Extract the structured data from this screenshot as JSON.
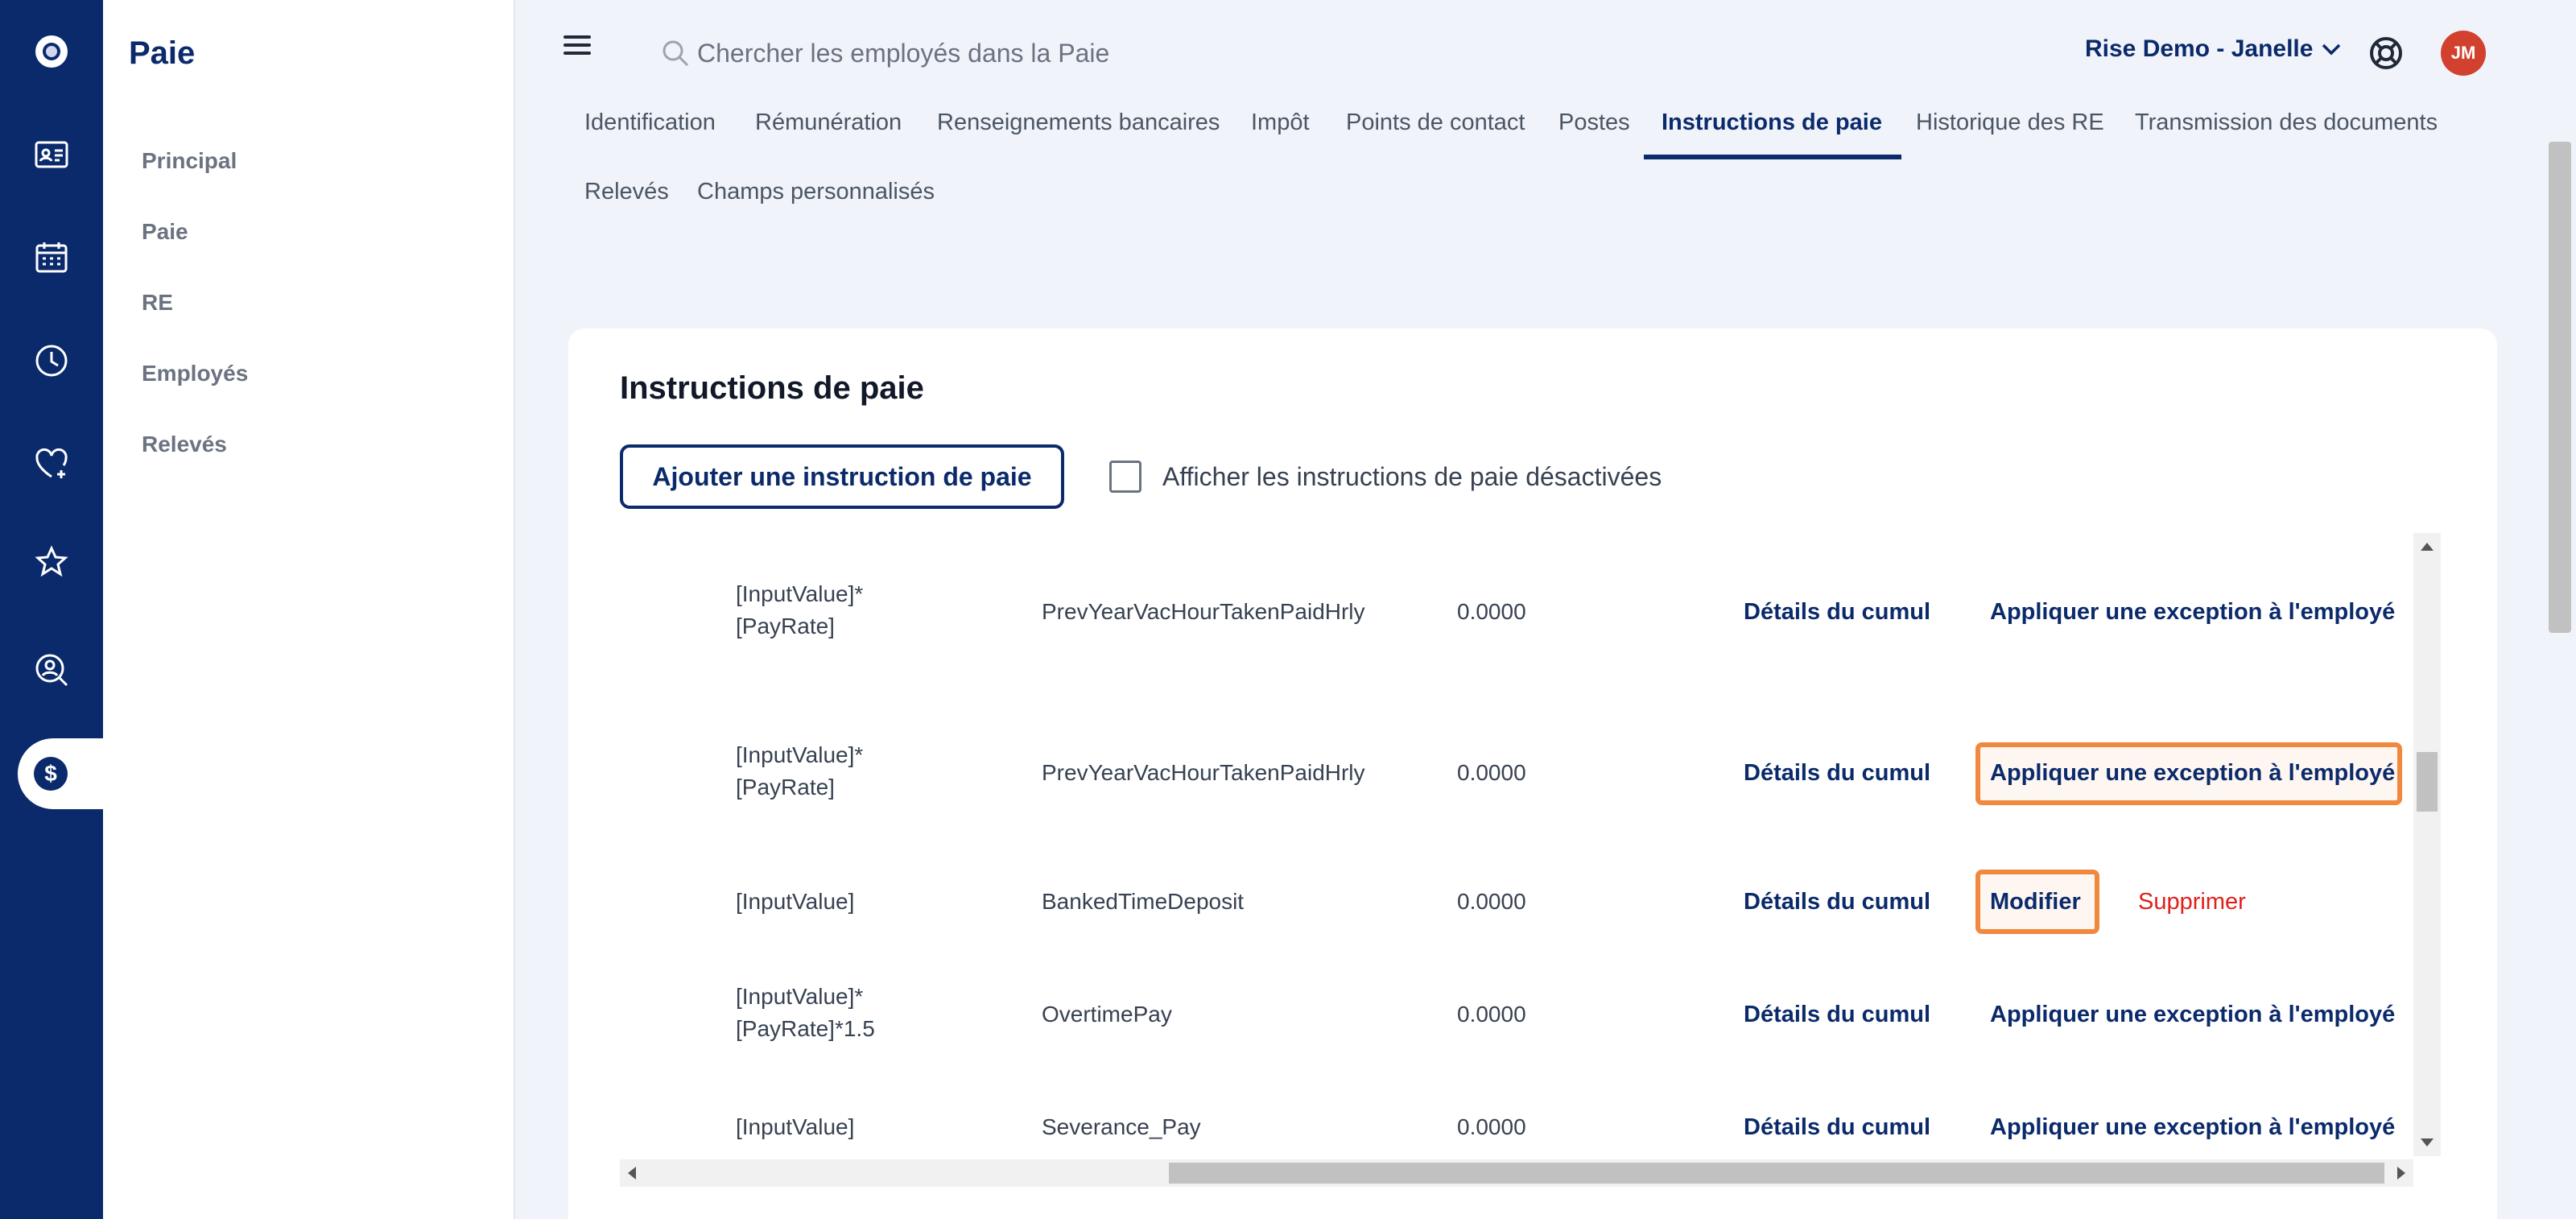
{
  "rail": {
    "icons": [
      "logo-icon",
      "id-card-icon",
      "calendar-icon",
      "clock-icon",
      "heart-plus-icon",
      "star-badge-icon",
      "search-person-icon",
      "dollar-icon"
    ]
  },
  "sidebar": {
    "title": "Paie",
    "items": [
      {
        "label": "Principal"
      },
      {
        "label": "Paie"
      },
      {
        "label": "RE"
      },
      {
        "label": "Employés"
      },
      {
        "label": "Relevés"
      }
    ]
  },
  "topbar": {
    "search_placeholder": "Chercher les employés dans la Paie",
    "company": "Rise Demo - Janelle",
    "avatar_initials": "JM"
  },
  "tabs": [
    {
      "label": "Identification"
    },
    {
      "label": "Rémunération"
    },
    {
      "label": "Renseignements bancaires"
    },
    {
      "label": "Impôt"
    },
    {
      "label": "Points de contact"
    },
    {
      "label": "Postes"
    },
    {
      "label": "Instructions de paie",
      "active": true
    },
    {
      "label": "Historique des RE"
    },
    {
      "label": "Transmission des documents"
    },
    {
      "label": "Relevés"
    },
    {
      "label": "Champs personnalisés"
    }
  ],
  "card": {
    "title": "Instructions de paie",
    "add_button": "Ajouter une instruction de paie",
    "show_disabled_label": "Afficher les instructions de paie désactivées",
    "show_disabled_checked": false
  },
  "rows": [
    {
      "formula": "[InputValue]* [PayRate]",
      "name": "PrevYearVacHourTakenPaidHrly",
      "value": "0.0000",
      "details": "Détails du cumul",
      "action": "Appliquer une exception à l'employé"
    },
    {
      "formula": "[InputValue]* [PayRate]",
      "name": "PrevYearVacHourTakenPaidHrly",
      "value": "0.0000",
      "details": "Détails du cumul",
      "action": "Appliquer une exception à l'employé"
    },
    {
      "formula": "[InputValue]",
      "name": "BankedTimeDeposit",
      "value": "0.0000",
      "details": "Détails du cumul",
      "action": "Modifier",
      "action2": "Supprimer"
    },
    {
      "formula": "[InputValue]* [PayRate]*1.5",
      "name": "OvertimePay",
      "value": "0.0000",
      "details": "Détails du cumul",
      "action": "Appliquer une exception à l'employé"
    },
    {
      "formula": "[InputValue]",
      "name": "Severance_Pay",
      "value": "0.0000",
      "details": "Détails du cumul",
      "action": "Appliquer une exception à l'employé"
    }
  ],
  "colors": {
    "brand": "#0b2a6b",
    "highlight": "#f0883e",
    "danger": "#e0201b",
    "avatar": "#d2402e"
  }
}
